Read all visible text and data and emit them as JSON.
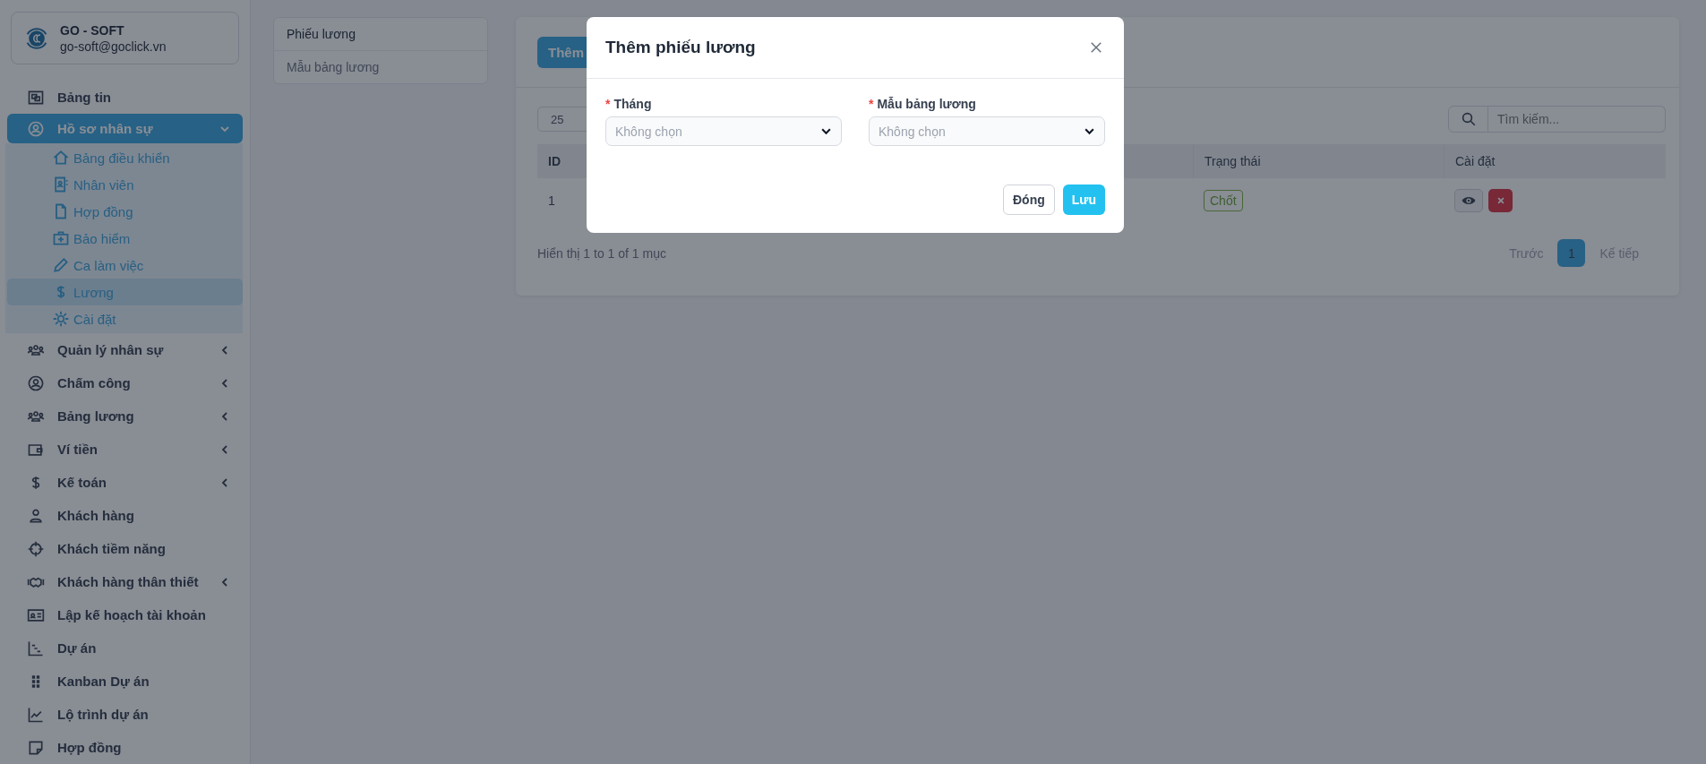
{
  "brand": {
    "name": "GO - SOFT",
    "email": "go-soft@goclick.vn"
  },
  "sidebar": {
    "items": [
      {
        "label": "Bảng tin",
        "selected": false
      },
      {
        "label": "Hồ sơ nhân sự",
        "selected": true,
        "expanded": true,
        "children": [
          {
            "label": "Bảng điều khiển",
            "selected": false
          },
          {
            "label": "Nhân viên",
            "selected": false
          },
          {
            "label": "Hợp đồng",
            "selected": false
          },
          {
            "label": "Bảo hiểm",
            "selected": false
          },
          {
            "label": "Ca làm việc",
            "selected": false
          },
          {
            "label": "Lương",
            "selected": true
          },
          {
            "label": "Cài đặt",
            "selected": false
          }
        ]
      },
      {
        "label": "Quản lý nhân sự",
        "selected": false,
        "expanded": false
      },
      {
        "label": "Chấm công",
        "selected": false,
        "expanded": false
      },
      {
        "label": "Bảng lương",
        "selected": false,
        "expanded": false
      },
      {
        "label": "Ví tiền",
        "selected": false,
        "expanded": false
      },
      {
        "label": "Kế toán",
        "selected": false,
        "expanded": false
      },
      {
        "label": "Khách hàng",
        "selected": false
      },
      {
        "label": "Khách tiềm năng",
        "selected": false
      },
      {
        "label": "Khách hàng thân thiết",
        "selected": false,
        "expanded": false
      },
      {
        "label": "Lập kế hoạch tài khoản",
        "selected": false
      },
      {
        "label": "Dự án",
        "selected": false
      },
      {
        "label": "Kanban Dự án",
        "selected": false
      },
      {
        "label": "Lộ trình dự án",
        "selected": false
      },
      {
        "label": "Hợp đồng",
        "selected": false
      }
    ]
  },
  "subnav": {
    "items": [
      {
        "label": "Phiếu lương",
        "selected": true
      },
      {
        "label": "Mẫu bảng lương",
        "selected": false
      }
    ]
  },
  "toolbar": {
    "add_button": "Thêm",
    "page_size": "25",
    "search": {
      "placeholder": "Tìm kiếm..."
    }
  },
  "table": {
    "columns": [
      "ID",
      "Trạng thái",
      "Cài đặt"
    ],
    "rows": [
      {
        "id": "1",
        "status": "Chốt"
      }
    ]
  },
  "footer": {
    "summary": "Hiển thị 1 to 1 of 1 mục",
    "pagination": {
      "prev": "Trước",
      "pages": [
        {
          "label": "1",
          "selected": true
        }
      ],
      "next": "Kế tiếp"
    }
  },
  "modal": {
    "title": "Thêm phiếu lương",
    "required_mark": "*",
    "fields": [
      {
        "label": "Tháng",
        "required": true,
        "placeholder": "Không chọn"
      },
      {
        "label": "Mẫu bảng lương",
        "required": true,
        "placeholder": "Không chọn"
      }
    ],
    "buttons": [
      {
        "label": "Đóng",
        "kind": "secondary"
      },
      {
        "label": "Lưu",
        "kind": "primary"
      }
    ]
  }
}
